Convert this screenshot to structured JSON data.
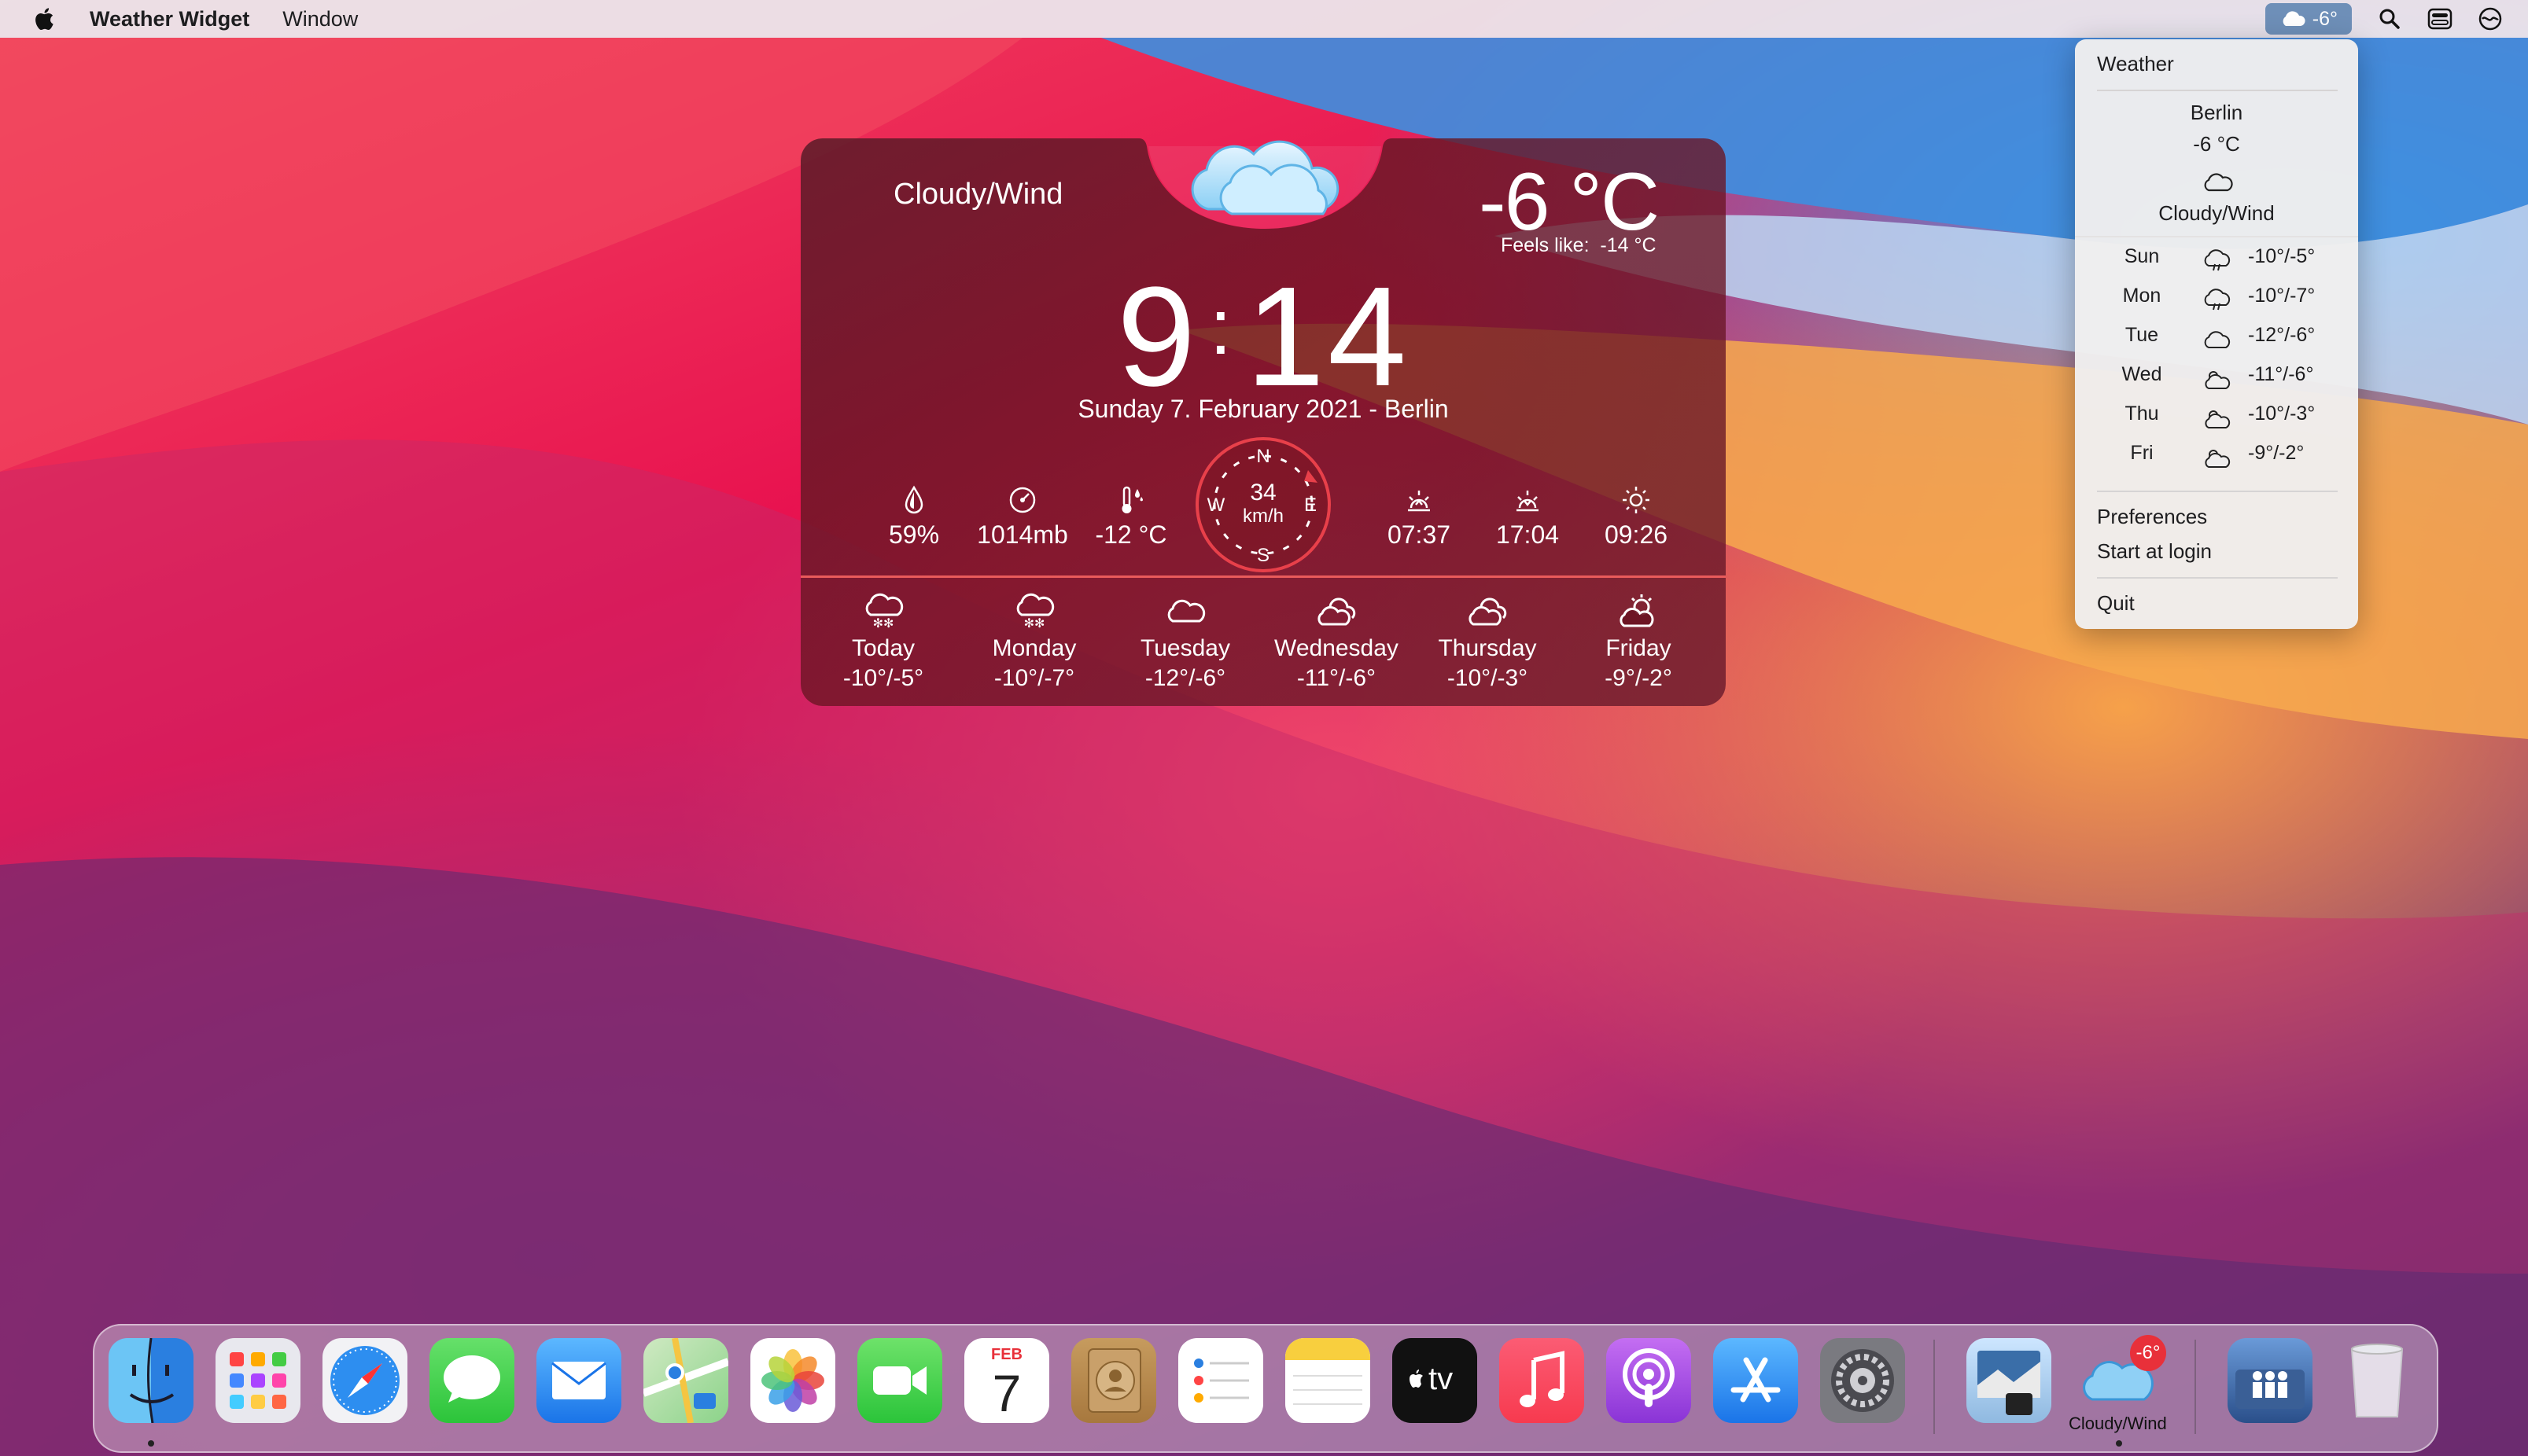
{
  "menubar": {
    "app_name": "Weather Widget",
    "menu_window": "Window",
    "weather_status": "-6°"
  },
  "widget": {
    "condition": "Cloudy/Wind",
    "temperature": "-6 °C",
    "feels_like": "Feels like:  -14 °C",
    "time_h": "9",
    "time_m": "14",
    "date": "Sunday 7. February 2021 - Berlin",
    "humidity": "59%",
    "pressure": "1014mb",
    "dew_point": "-12 °C",
    "wind_speed": "34",
    "wind_unit": "km/h",
    "compass_n": "N",
    "compass_e": "E",
    "compass_s": "S",
    "compass_w": "W",
    "sunrise": "07:37",
    "sunset": "17:04",
    "daylight": "09:26",
    "forecast": [
      {
        "day": "Today",
        "temp": "-10°/-5°",
        "icon": "snow-cloud-icon"
      },
      {
        "day": "Monday",
        "temp": "-10°/-7°",
        "icon": "snow-cloud-icon"
      },
      {
        "day": "Tuesday",
        "temp": "-12°/-6°",
        "icon": "cloud-icon"
      },
      {
        "day": "Wednesday",
        "temp": "-11°/-6°",
        "icon": "cloudy-icon"
      },
      {
        "day": "Thursday",
        "temp": "-10°/-3°",
        "icon": "cloudy-icon"
      },
      {
        "day": "Friday",
        "temp": "-9°/-2°",
        "icon": "partly-cloudy-icon"
      }
    ]
  },
  "menu": {
    "header": "Weather",
    "city": "Berlin",
    "temperature": "-6 °C",
    "condition": "Cloudy/Wind",
    "forecast": [
      {
        "day": "Sun",
        "temp": "-10°/-5°"
      },
      {
        "day": "Mon",
        "temp": "-10°/-7°"
      },
      {
        "day": "Tue",
        "temp": "-12°/-6°"
      },
      {
        "day": "Wed",
        "temp": "-11°/-6°"
      },
      {
        "day": "Thu",
        "temp": "-10°/-3°"
      },
      {
        "day": "Fri",
        "temp": "-9°/-2°"
      }
    ],
    "preferences": "Preferences",
    "start_at_login": "Start at login",
    "quit": "Quit"
  },
  "dock": {
    "calendar_month": "FEB",
    "calendar_day": "7",
    "tv_label": "tv",
    "weather_badge": "-6°",
    "weather_label": "Cloudy/Wind"
  },
  "colors": {
    "compass_ring": "#e8404a",
    "divider": "#e95b5b",
    "menubar_highlight": "#6e8fb8",
    "badge": "#e8303a"
  }
}
